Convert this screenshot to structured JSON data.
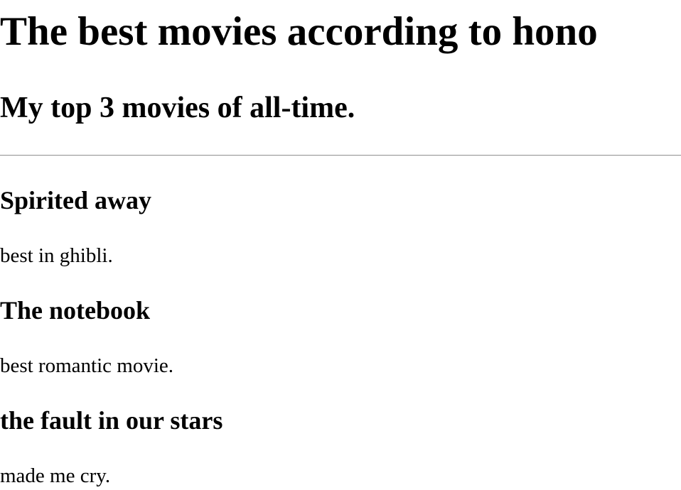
{
  "page": {
    "title": "The best movies according to hono",
    "subtitle": "My top 3 movies of all-time."
  },
  "movies": [
    {
      "title": "Spirited away",
      "description": "best in ghibli."
    },
    {
      "title": "The notebook",
      "description": "best romantic movie."
    },
    {
      "title": "the fault in our stars",
      "description": "made me cry."
    }
  ]
}
